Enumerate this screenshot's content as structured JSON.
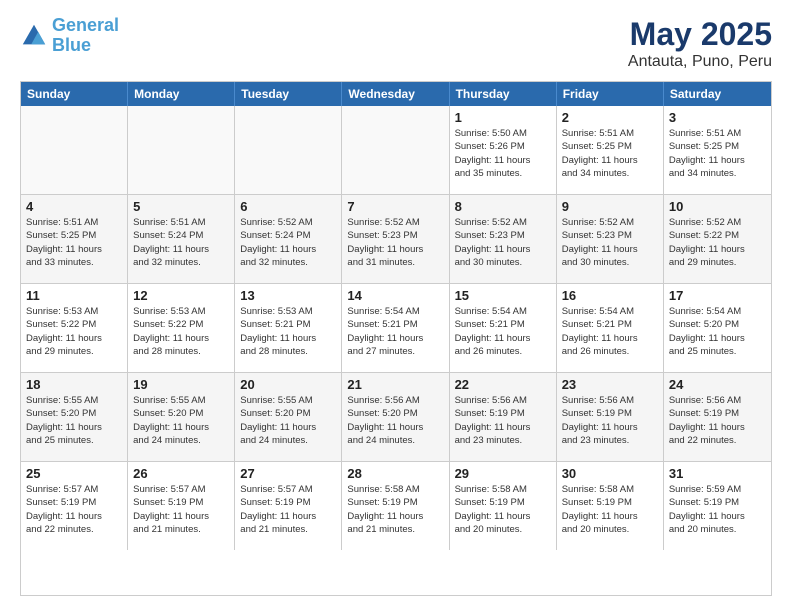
{
  "logo": {
    "line1": "General",
    "line2": "Blue"
  },
  "title": "May 2025",
  "subtitle": "Antauta, Puno, Peru",
  "days_header": [
    "Sunday",
    "Monday",
    "Tuesday",
    "Wednesday",
    "Thursday",
    "Friday",
    "Saturday"
  ],
  "rows": [
    [
      {
        "day": "",
        "info": ""
      },
      {
        "day": "",
        "info": ""
      },
      {
        "day": "",
        "info": ""
      },
      {
        "day": "",
        "info": ""
      },
      {
        "day": "1",
        "info": "Sunrise: 5:50 AM\nSunset: 5:26 PM\nDaylight: 11 hours\nand 35 minutes."
      },
      {
        "day": "2",
        "info": "Sunrise: 5:51 AM\nSunset: 5:25 PM\nDaylight: 11 hours\nand 34 minutes."
      },
      {
        "day": "3",
        "info": "Sunrise: 5:51 AM\nSunset: 5:25 PM\nDaylight: 11 hours\nand 34 minutes."
      }
    ],
    [
      {
        "day": "4",
        "info": "Sunrise: 5:51 AM\nSunset: 5:25 PM\nDaylight: 11 hours\nand 33 minutes."
      },
      {
        "day": "5",
        "info": "Sunrise: 5:51 AM\nSunset: 5:24 PM\nDaylight: 11 hours\nand 32 minutes."
      },
      {
        "day": "6",
        "info": "Sunrise: 5:52 AM\nSunset: 5:24 PM\nDaylight: 11 hours\nand 32 minutes."
      },
      {
        "day": "7",
        "info": "Sunrise: 5:52 AM\nSunset: 5:23 PM\nDaylight: 11 hours\nand 31 minutes."
      },
      {
        "day": "8",
        "info": "Sunrise: 5:52 AM\nSunset: 5:23 PM\nDaylight: 11 hours\nand 30 minutes."
      },
      {
        "day": "9",
        "info": "Sunrise: 5:52 AM\nSunset: 5:23 PM\nDaylight: 11 hours\nand 30 minutes."
      },
      {
        "day": "10",
        "info": "Sunrise: 5:52 AM\nSunset: 5:22 PM\nDaylight: 11 hours\nand 29 minutes."
      }
    ],
    [
      {
        "day": "11",
        "info": "Sunrise: 5:53 AM\nSunset: 5:22 PM\nDaylight: 11 hours\nand 29 minutes."
      },
      {
        "day": "12",
        "info": "Sunrise: 5:53 AM\nSunset: 5:22 PM\nDaylight: 11 hours\nand 28 minutes."
      },
      {
        "day": "13",
        "info": "Sunrise: 5:53 AM\nSunset: 5:21 PM\nDaylight: 11 hours\nand 28 minutes."
      },
      {
        "day": "14",
        "info": "Sunrise: 5:54 AM\nSunset: 5:21 PM\nDaylight: 11 hours\nand 27 minutes."
      },
      {
        "day": "15",
        "info": "Sunrise: 5:54 AM\nSunset: 5:21 PM\nDaylight: 11 hours\nand 26 minutes."
      },
      {
        "day": "16",
        "info": "Sunrise: 5:54 AM\nSunset: 5:21 PM\nDaylight: 11 hours\nand 26 minutes."
      },
      {
        "day": "17",
        "info": "Sunrise: 5:54 AM\nSunset: 5:20 PM\nDaylight: 11 hours\nand 25 minutes."
      }
    ],
    [
      {
        "day": "18",
        "info": "Sunrise: 5:55 AM\nSunset: 5:20 PM\nDaylight: 11 hours\nand 25 minutes."
      },
      {
        "day": "19",
        "info": "Sunrise: 5:55 AM\nSunset: 5:20 PM\nDaylight: 11 hours\nand 24 minutes."
      },
      {
        "day": "20",
        "info": "Sunrise: 5:55 AM\nSunset: 5:20 PM\nDaylight: 11 hours\nand 24 minutes."
      },
      {
        "day": "21",
        "info": "Sunrise: 5:56 AM\nSunset: 5:20 PM\nDaylight: 11 hours\nand 24 minutes."
      },
      {
        "day": "22",
        "info": "Sunrise: 5:56 AM\nSunset: 5:19 PM\nDaylight: 11 hours\nand 23 minutes."
      },
      {
        "day": "23",
        "info": "Sunrise: 5:56 AM\nSunset: 5:19 PM\nDaylight: 11 hours\nand 23 minutes."
      },
      {
        "day": "24",
        "info": "Sunrise: 5:56 AM\nSunset: 5:19 PM\nDaylight: 11 hours\nand 22 minutes."
      }
    ],
    [
      {
        "day": "25",
        "info": "Sunrise: 5:57 AM\nSunset: 5:19 PM\nDaylight: 11 hours\nand 22 minutes."
      },
      {
        "day": "26",
        "info": "Sunrise: 5:57 AM\nSunset: 5:19 PM\nDaylight: 11 hours\nand 21 minutes."
      },
      {
        "day": "27",
        "info": "Sunrise: 5:57 AM\nSunset: 5:19 PM\nDaylight: 11 hours\nand 21 minutes."
      },
      {
        "day": "28",
        "info": "Sunrise: 5:58 AM\nSunset: 5:19 PM\nDaylight: 11 hours\nand 21 minutes."
      },
      {
        "day": "29",
        "info": "Sunrise: 5:58 AM\nSunset: 5:19 PM\nDaylight: 11 hours\nand 20 minutes."
      },
      {
        "day": "30",
        "info": "Sunrise: 5:58 AM\nSunset: 5:19 PM\nDaylight: 11 hours\nand 20 minutes."
      },
      {
        "day": "31",
        "info": "Sunrise: 5:59 AM\nSunset: 5:19 PM\nDaylight: 11 hours\nand 20 minutes."
      }
    ]
  ]
}
